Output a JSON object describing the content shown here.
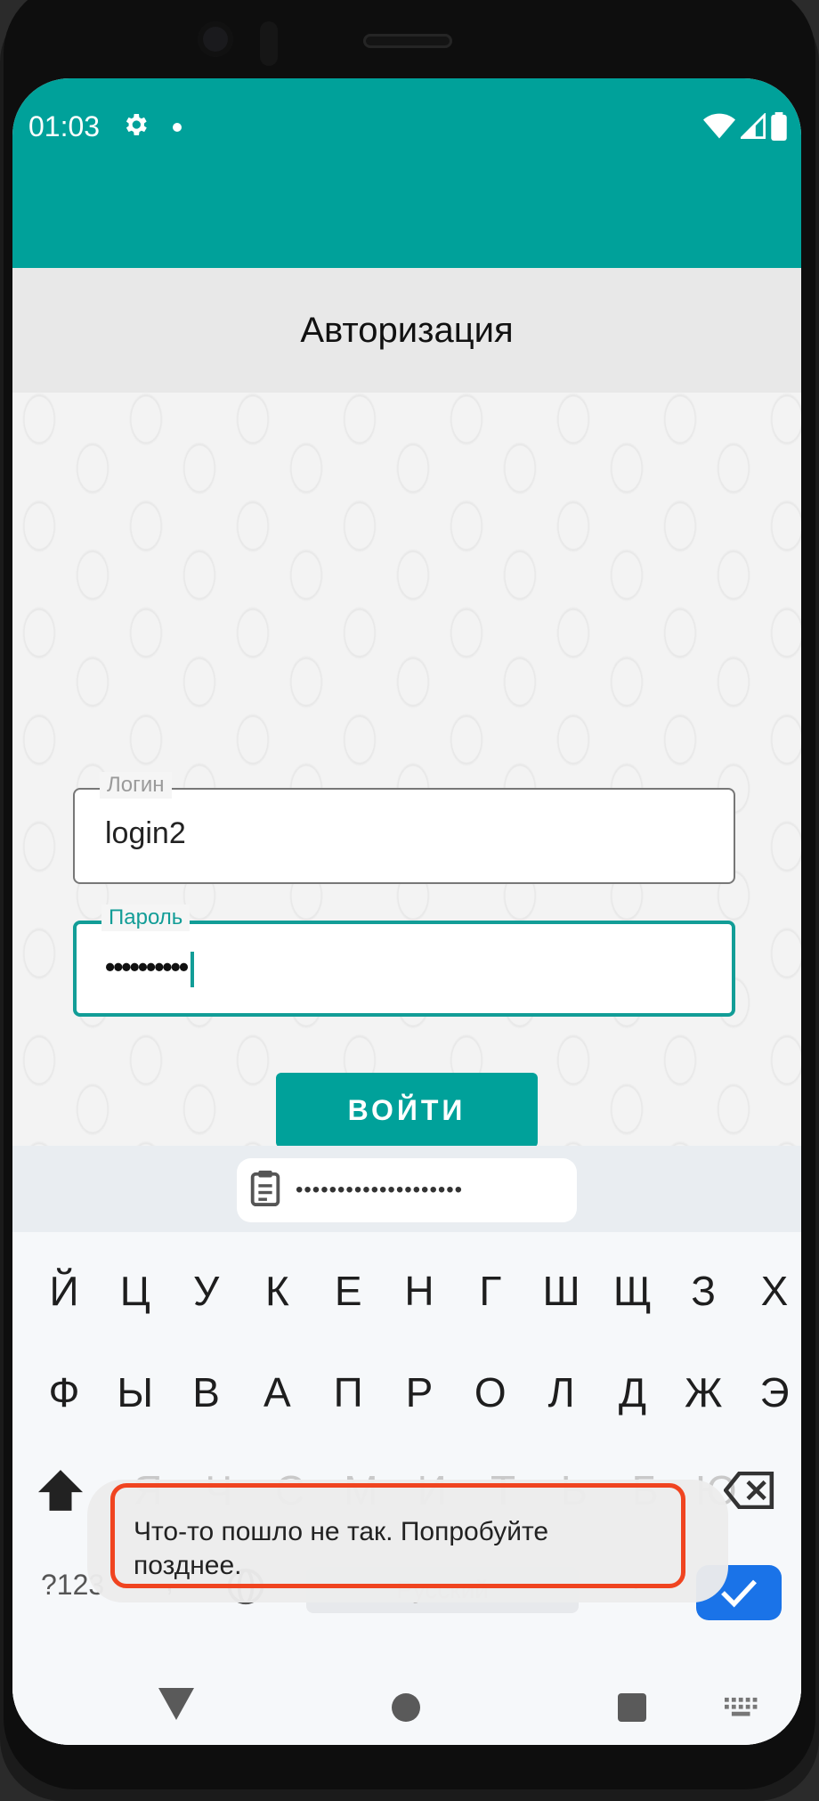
{
  "status": {
    "time": "01:03"
  },
  "header": {
    "title": "Авторизация"
  },
  "form": {
    "login_label": "Логин",
    "login_value": "login2",
    "password_label": "Пароль",
    "password_value": "••••••••••",
    "submit_label": "ВОЙТИ"
  },
  "keyboard": {
    "clipboard_text": "••••••••••••••••••••",
    "row1": [
      "Й",
      "Ц",
      "У",
      "К",
      "Е",
      "Н",
      "Г",
      "Ш",
      "Щ",
      "З",
      "Х"
    ],
    "row2": [
      "Ф",
      "Ы",
      "В",
      "А",
      "П",
      "Р",
      "О",
      "Л",
      "Д",
      "Ж",
      "Э"
    ],
    "row3": [
      "Я",
      "Ч",
      "С",
      "М",
      "И",
      "Т",
      "Ь",
      "Б",
      "Ю"
    ],
    "symbols_label": "?123",
    "comma_label": ",",
    "space_label": "Русский",
    "period_label": "."
  },
  "toast": {
    "message": "Что-то пошло не так. Попробуйте позднее."
  },
  "colors": {
    "accent": "#00a19a",
    "highlight": "#f04420",
    "enter": "#1a73e8"
  },
  "icons": {
    "settings": "gear-icon",
    "wifi": "wifi-icon",
    "signal": "signal-icon",
    "battery": "battery-icon",
    "clipboard": "clipboard-icon",
    "shift": "shift-icon",
    "delete": "backspace-icon",
    "globe": "globe-icon",
    "enter": "check-icon",
    "back": "back-icon",
    "home": "home-icon",
    "recent": "recent-apps-icon",
    "keyboard": "keyboard-icon"
  }
}
